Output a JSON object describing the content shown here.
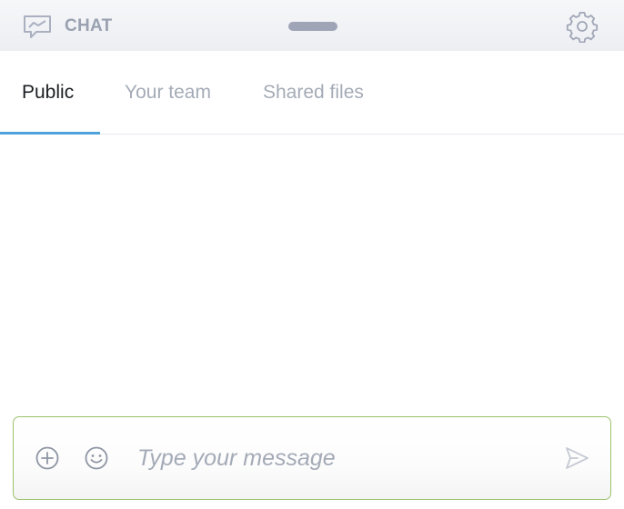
{
  "header": {
    "title": "CHAT",
    "chat_icon": "chat-bubble-icon",
    "settings_icon": "gear-icon"
  },
  "tabs": [
    {
      "label": "Public",
      "active": true
    },
    {
      "label": "Your team",
      "active": false
    },
    {
      "label": "Shared files",
      "active": false
    }
  ],
  "composer": {
    "placeholder": "Type your message",
    "value": "",
    "attach_icon": "plus-circle-icon",
    "emoji_icon": "smiley-icon",
    "send_icon": "send-icon"
  },
  "colors": {
    "accent_tab_underline": "#4da3d9",
    "composer_border": "#9bc36a",
    "muted_text": "#a4abb6",
    "active_text": "#1b1e22",
    "handle": "#a0a4b7"
  }
}
